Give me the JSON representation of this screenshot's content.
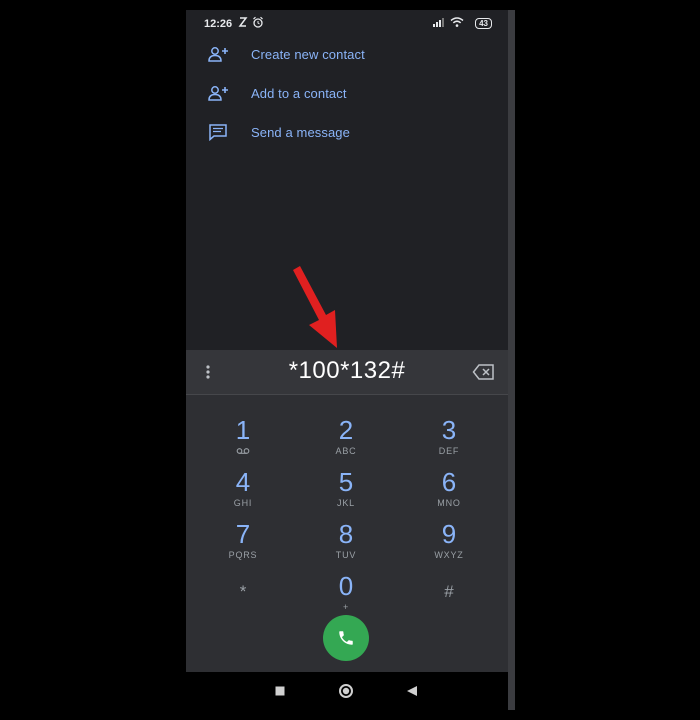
{
  "status": {
    "time": "12:26",
    "battery": "43"
  },
  "actions": [
    {
      "label": "Create new contact",
      "icon": "person-add-icon"
    },
    {
      "label": "Add to a contact",
      "icon": "person-add-icon"
    },
    {
      "label": "Send a message",
      "icon": "message-icon"
    }
  ],
  "dialer": {
    "number": "*100*132#",
    "keys": [
      {
        "digit": "1",
        "letters": ""
      },
      {
        "digit": "2",
        "letters": "ABC"
      },
      {
        "digit": "3",
        "letters": "DEF"
      },
      {
        "digit": "4",
        "letters": "GHI"
      },
      {
        "digit": "5",
        "letters": "JKL"
      },
      {
        "digit": "6",
        "letters": "MNO"
      },
      {
        "digit": "7",
        "letters": "PQRS"
      },
      {
        "digit": "8",
        "letters": "TUV"
      },
      {
        "digit": "9",
        "letters": "WXYZ"
      },
      {
        "digit": "*",
        "letters": ""
      },
      {
        "digit": "0",
        "letters": "+"
      },
      {
        "digit": "#",
        "letters": ""
      }
    ]
  },
  "colors": {
    "accent": "#8ab4f8",
    "call": "#34a853",
    "background": "#202125",
    "arrow": "#e02020"
  }
}
